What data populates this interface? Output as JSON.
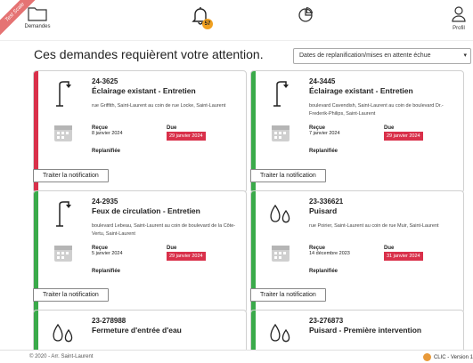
{
  "header": {
    "ribbon": "Test Scale",
    "nav": [
      {
        "label": "Demandes",
        "icon": "folder-icon"
      },
      {
        "label": "",
        "icon": "bell-icon",
        "badge": "57"
      },
      {
        "label": "",
        "icon": "pie-chart-icon"
      },
      {
        "label": "Profil",
        "icon": "user-icon"
      }
    ]
  },
  "main": {
    "title": "Ces demandes requièrent votre attention.",
    "filter": {
      "selected": "Dates de replanification/mises en attente échue"
    }
  },
  "cards": [
    {
      "number": "24-3625",
      "type": "Éclairage existant - Entretien",
      "address": "rue Griffith, Saint-Laurent au coin de rue Locke, Saint-Laurent",
      "recue_label": "Reçue",
      "recue": "8 janvier 2024",
      "due_label": "Due",
      "due": "29 janvier 2024",
      "state": "Replanifiée",
      "icon": "street-lamp-icon",
      "status_color": "#d9304a",
      "button": "Traiter la notification"
    },
    {
      "number": "24-3445",
      "type": "Éclairage existant - Entretien",
      "address": "boulevard Cavendish, Saint-Laurent au coin de boulevard Dr.-Frederik-Philips, Saint-Laurent",
      "recue_label": "Reçue",
      "recue": "7 janvier 2024",
      "due_label": "Due",
      "due": "29 janvier 2024",
      "state": "Replanifiée",
      "icon": "street-lamp-icon",
      "status_color": "#3aaa4a",
      "button": "Traiter la notification"
    },
    {
      "number": "24-2935",
      "type": "Feux de circulation - Entretien",
      "address": "boulevard Lebeau, Saint-Laurent au coin de boulevard de la Côte-Vertu, Saint-Laurent",
      "recue_label": "Reçue",
      "recue": "5 janvier 2024",
      "due_label": "Due",
      "due": "29 janvier 2024",
      "state": "Replanifiée",
      "icon": "street-lamp-icon",
      "status_color": "#3aaa4a",
      "button": "Traiter la notification"
    },
    {
      "number": "23-336621",
      "type": "Puisard",
      "address": "rue Poirier, Saint-Laurent au coin de rue Muir, Saint-Laurent",
      "recue_label": "Reçue",
      "recue": "14 décembre 2023",
      "due_label": "Due",
      "due": "31 janvier 2024",
      "state": "Replanifiée",
      "icon": "water-drops-icon",
      "status_color": "#3aaa4a",
      "button": "Traiter la notification"
    },
    {
      "number": "23-278988",
      "type": "Fermeture d'entrée d'eau",
      "address": "",
      "icon": "water-drops-icon",
      "status_color": "#3aaa4a"
    },
    {
      "number": "23-276873",
      "type": "Puisard - Première intervention",
      "address": "",
      "icon": "water-drops-icon",
      "status_color": "#3aaa4a"
    }
  ],
  "footer": {
    "copyright": "© 2020 - Arr. Saint-Laurent",
    "version": "CLIC - Version 1"
  }
}
